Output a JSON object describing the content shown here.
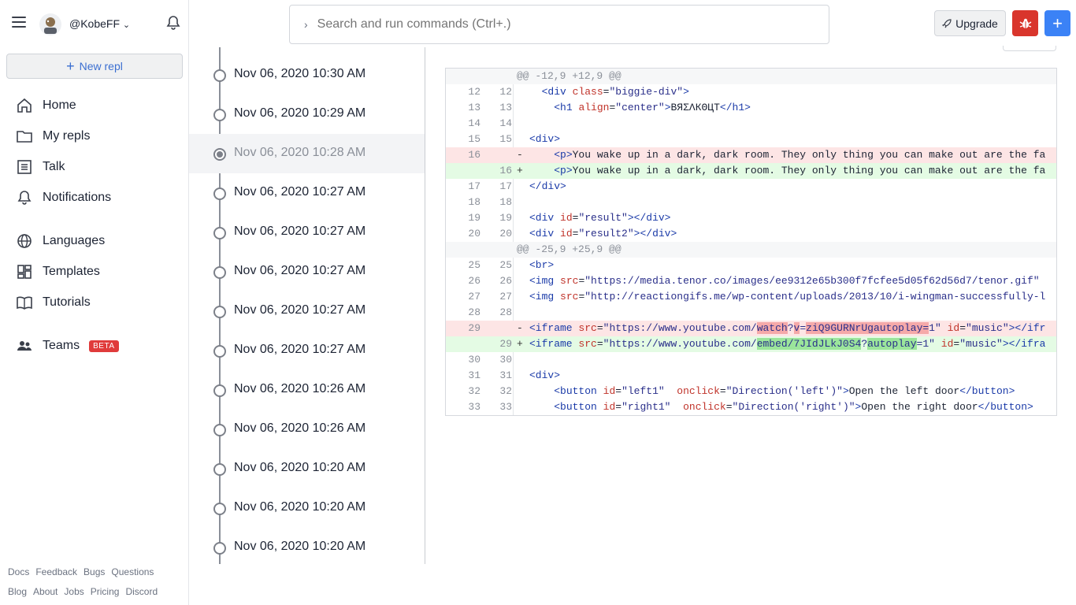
{
  "header": {
    "username": "@KobeFF",
    "search_placeholder": "Search and run commands (Ctrl+.)",
    "upgrade_label": "Upgrade"
  },
  "sidebar": {
    "new_repl_label": "New repl",
    "items": [
      {
        "label": "Home",
        "icon": "home-icon"
      },
      {
        "label": "My repls",
        "icon": "folder-icon"
      },
      {
        "label": "Talk",
        "icon": "talk-icon"
      },
      {
        "label": "Notifications",
        "icon": "bell-icon"
      },
      {
        "label": "Languages",
        "icon": "globe-icon"
      },
      {
        "label": "Templates",
        "icon": "templates-icon"
      },
      {
        "label": "Tutorials",
        "icon": "book-icon"
      },
      {
        "label": "Teams",
        "icon": "teams-icon",
        "badge": "BETA"
      }
    ],
    "footer_row1": [
      "Docs",
      "Feedback",
      "Bugs",
      "Questions"
    ],
    "footer_row2": [
      "Blog",
      "About",
      "Jobs",
      "Pricing",
      "Discord"
    ]
  },
  "timeline": {
    "items": [
      "Nov 06, 2020 10:30 AM",
      "Nov 06, 2020 10:29 AM",
      "Nov 06, 2020 10:28 AM",
      "Nov 06, 2020 10:27 AM",
      "Nov 06, 2020 10:27 AM",
      "Nov 06, 2020 10:27 AM",
      "Nov 06, 2020 10:27 AM",
      "Nov 06, 2020 10:27 AM",
      "Nov 06, 2020 10:26 AM",
      "Nov 06, 2020 10:26 AM",
      "Nov 06, 2020 10:20 AM",
      "Nov 06, 2020 10:20 AM",
      "Nov 06, 2020 10:20 AM"
    ],
    "selected_index": 2
  },
  "diff": {
    "hunk1": "@@ -12,9 +12,9 @@",
    "hunk2": "@@ -25,9 +25,9 @@",
    "lines": {
      "l12": {
        "o": "12",
        "n": "12"
      },
      "l13": {
        "o": "13",
        "n": "13"
      },
      "l14": {
        "o": "14",
        "n": "14"
      },
      "l15": {
        "o": "15",
        "n": "15"
      },
      "l16d": {
        "o": "16",
        "sign": "-",
        "text": "You wake up in a dark, dark room. They only thing you can make out are the fa"
      },
      "l16a": {
        "n": "16",
        "sign": "+",
        "text": "You wake up in a dark, dark room. They only thing you can make out are the fa"
      },
      "l17": {
        "o": "17",
        "n": "17"
      },
      "l18": {
        "o": "18",
        "n": "18"
      },
      "l19": {
        "o": "19",
        "n": "19"
      },
      "l20": {
        "o": "20",
        "n": "20"
      },
      "l25": {
        "o": "25",
        "n": "25"
      },
      "l26": {
        "o": "26",
        "n": "26"
      },
      "l27": {
        "o": "27",
        "n": "27"
      },
      "l28": {
        "o": "28",
        "n": "28"
      },
      "l29d": {
        "o": "29",
        "sign": "-"
      },
      "l29a": {
        "n": "29",
        "sign": "+"
      },
      "l30": {
        "o": "30",
        "n": "30"
      },
      "l31": {
        "o": "31",
        "n": "31"
      },
      "l32": {
        "o": "32",
        "n": "32",
        "text": "Open the left door"
      },
      "l33": {
        "o": "33",
        "n": "33",
        "text": "Open the right door"
      }
    },
    "strings": {
      "biggie": "\"biggie-div\"",
      "center": "\"center\"",
      "h1_text": "ВЯΣΛКΘЦТ",
      "result": "\"result\"",
      "result2": "\"result2\"",
      "tenor": "\"https://media.tenor.co/images/ee9312e65b300f7fcfee5d05f62d56d7/tenor.gif\"",
      "reactiongifs": "\"http://reactiongifs.me/wp-content/uploads/2013/10/i-wingman-successfully-l",
      "yt_prefix": "\"https://www.youtube.com/",
      "watch": "watch",
      "v": "v",
      "vid_old": "ziQ9GURNrUgautoplay=",
      "embed": "embed/7JIdJLkJ0S4",
      "autoplay": "autoplay",
      "one": "1\"",
      "music": "\"music\"",
      "left1": "\"left1\"",
      "right1": "\"right1\"",
      "dir_left": "\"Direction('left')\"",
      "dir_right": "\"Direction('right')\""
    }
  }
}
